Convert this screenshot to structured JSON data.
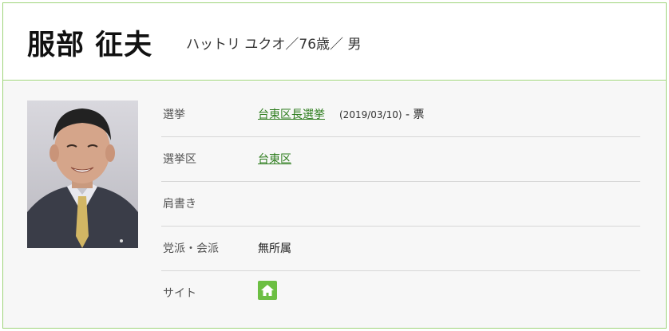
{
  "candidate": {
    "name": "服部 征夫",
    "kana_age_gender": "ハットリ ユクオ／76歳／ 男"
  },
  "details": {
    "election": {
      "label": "選挙",
      "link_text": "台東区長選挙",
      "date": "(2019/03/10)",
      "votes": "- 票"
    },
    "district": {
      "label": "選挙区",
      "link_text": "台東区"
    },
    "title": {
      "label": "肩書き",
      "value": ""
    },
    "party": {
      "label": "党派・会派",
      "value": "無所属"
    },
    "site": {
      "label": "サイト",
      "icon": "home-icon"
    }
  },
  "colors": {
    "border": "#9fd47a",
    "link": "#2e7d1e",
    "home_button": "#6cbf43"
  }
}
